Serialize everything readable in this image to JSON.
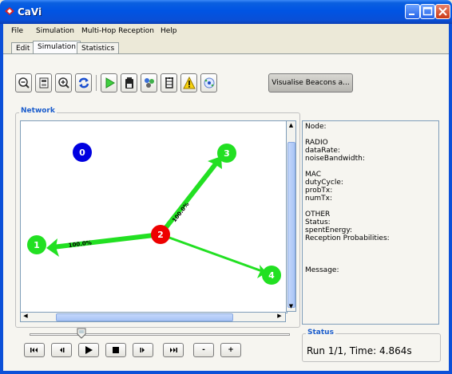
{
  "window": {
    "title": "CaVi"
  },
  "menu": [
    "File",
    "Simulation",
    "Multi-Hop Reception",
    "Help"
  ],
  "tabs": [
    "Edit",
    "Simulation",
    "Statistics"
  ],
  "toolbar": {
    "icons": [
      "zoom-out-icon",
      "zoom-fit-icon",
      "zoom-in-icon",
      "refresh-icon",
      "play-icon",
      "battery-icon",
      "node-group-icon",
      "tower-icon",
      "warning-icon",
      "beacon-icon"
    ],
    "visualise_label": "Visualise Beacons a..."
  },
  "network": {
    "label": "Network",
    "nodes": [
      {
        "id": "0",
        "color": "#0000e0"
      },
      {
        "id": "1",
        "color": "#22e022"
      },
      {
        "id": "2",
        "color": "#ee0000"
      },
      {
        "id": "3",
        "color": "#22e022"
      },
      {
        "id": "4",
        "color": "#22e022"
      }
    ],
    "links": [
      {
        "from": "2",
        "to": "1",
        "label": "100.0%"
      },
      {
        "from": "2",
        "to": "3",
        "label": "100.0%"
      },
      {
        "from": "2",
        "to": "4",
        "label": ""
      }
    ],
    "link_color": "#22e022"
  },
  "info": {
    "node": "Node:",
    "radio_header": "RADIO",
    "data_rate": "dataRate:",
    "noise_bandwidth": "noiseBandwidth:",
    "mac_header": "MAC",
    "duty_cycle": "dutyCycle:",
    "prob_tx": "probTx:",
    "num_tx": "numTx:",
    "other_header": "OTHER",
    "status": "Status:",
    "spent_energy": "spentEnergy:",
    "reception_probabilities": "Reception Probabilities:",
    "message": "Message:"
  },
  "controls": {
    "minus_label": "-",
    "plus_label": "+"
  },
  "status": {
    "label": "Status",
    "text": "Run 1/1, Time:  4.864s"
  }
}
